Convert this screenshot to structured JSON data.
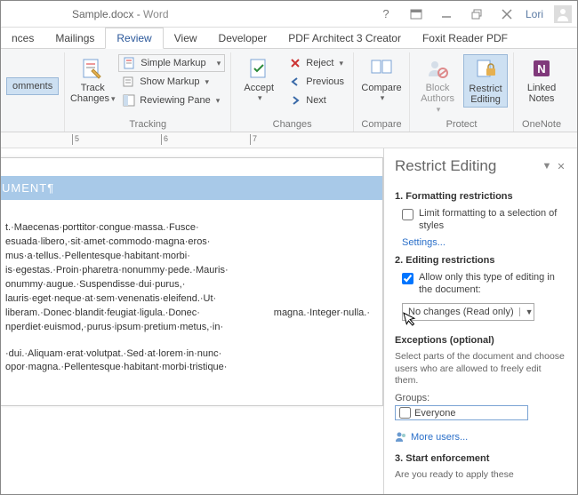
{
  "title": {
    "doc": "Sample.docx",
    "sep": " - ",
    "app": "Word"
  },
  "user": "Lori",
  "tabs": [
    "nces",
    "Mailings",
    "Review",
    "View",
    "Developer",
    "PDF Architect 3 Creator",
    "Foxit Reader PDF"
  ],
  "active_tab_index": 2,
  "ribbon": {
    "comments": {
      "label": "omments",
      "group": ""
    },
    "tracking": {
      "track_changes": "Track\nChanges",
      "markup": "Simple Markup",
      "show_markup": "Show Markup",
      "reviewing_pane": "Reviewing Pane",
      "group": "Tracking"
    },
    "changes": {
      "accept": "Accept",
      "reject": "Reject",
      "previous": "Previous",
      "next": "Next",
      "group": "Changes"
    },
    "compare": {
      "compare": "Compare",
      "group": "Compare"
    },
    "protect": {
      "block": "Block\nAuthors",
      "restrict": "Restrict\nEditing",
      "group": "Protect"
    },
    "onenote": {
      "linked": "Linked\nNotes",
      "group": "OneNote"
    }
  },
  "ruler": {
    "marks": [
      "5",
      "6",
      "7"
    ]
  },
  "document": {
    "heading": "UMENT¶",
    "body1": "t.·Maecenas·porttitor·congue·massa.·Fusce· esuada·libero,·sit·amet·commodo·magna·eros· mus·a·tellus.·Pellentesque·habitant·morbi· is·egestas.·Proin·pharetra·nonummy·pede.·Mauris· onummy·augue.·Suspendisse·dui·purus,· lauris·eget·neque·at·sem·venenatis·eleifend.·Ut· liberam.·Donec·blandit·feugiat·ligula.·Donec· magna.·Integer·nulla.· nperdiet·euismod,·purus·ipsum·pretium·metus,·in·",
    "body2": "·dui.·Aliquam·erat·volutpat.·Sed·at·lorem·in·nunc· opor·magna.·Pellentesque·habitant·morbi·tristique·"
  },
  "pane": {
    "title": "Restrict Editing",
    "s1": {
      "h": "1. Formatting restrictions",
      "check": "Limit formatting to a selection of styles",
      "settings": "Settings..."
    },
    "s2": {
      "h": "2. Editing restrictions",
      "check": "Allow only this type of editing in the document:",
      "dd": "No changes (Read only)"
    },
    "ex": {
      "h": "Exceptions (optional)",
      "desc": "Select parts of the document and choose users who are allowed to freely edit them.",
      "groups_lbl": "Groups:",
      "everyone": "Everyone",
      "more": "More users..."
    },
    "s3": {
      "h": "3. Start enforcement",
      "q": "Are you ready to apply these"
    }
  }
}
